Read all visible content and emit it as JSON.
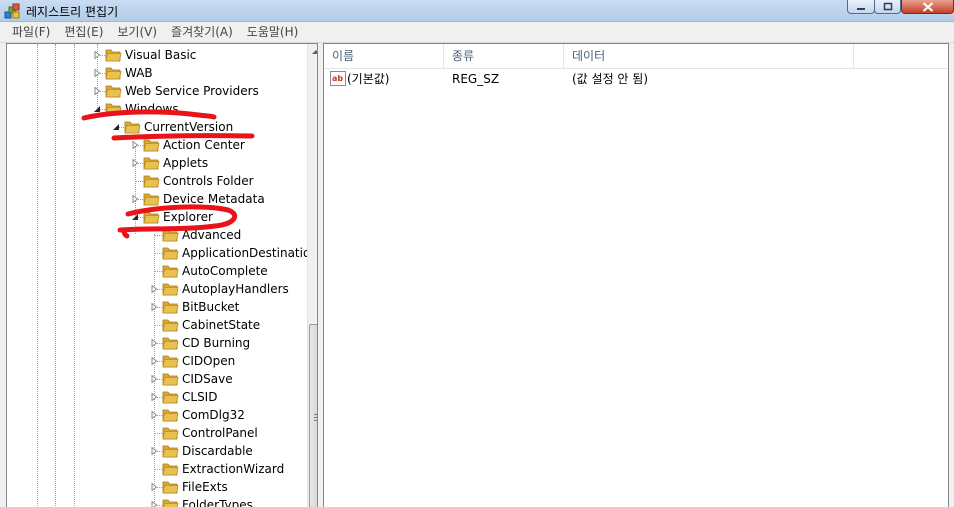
{
  "window": {
    "title": "레지스트리 편집기",
    "icons": {
      "app": "registry-editor-icon",
      "minimize": "minimize-icon",
      "maximize": "maximize-icon",
      "close": "close-icon"
    }
  },
  "menu": [
    "파일(F)",
    "편집(E)",
    "보기(V)",
    "즐겨찾기(A)",
    "도움말(H)"
  ],
  "tree": [
    {
      "label": "Visual Basic",
      "expander": "collapsed"
    },
    {
      "label": "WAB",
      "expander": "collapsed"
    },
    {
      "label": "Web Service Providers",
      "expander": "collapsed"
    },
    {
      "label": "Windows",
      "expander": "expanded"
    },
    {
      "label": "CurrentVersion",
      "expander": "expanded"
    },
    {
      "label": "Action Center",
      "expander": "collapsed"
    },
    {
      "label": "Applets",
      "expander": "collapsed"
    },
    {
      "label": "Controls Folder",
      "expander": "none"
    },
    {
      "label": "Device Metadata",
      "expander": "collapsed"
    },
    {
      "label": "Explorer",
      "expander": "expanded"
    },
    {
      "label": "Advanced",
      "expander": "none"
    },
    {
      "label": "ApplicationDestinations",
      "expander": "none"
    },
    {
      "label": "AutoComplete",
      "expander": "none"
    },
    {
      "label": "AutoplayHandlers",
      "expander": "collapsed"
    },
    {
      "label": "BitBucket",
      "expander": "collapsed"
    },
    {
      "label": "CabinetState",
      "expander": "none"
    },
    {
      "label": "CD Burning",
      "expander": "collapsed"
    },
    {
      "label": "CIDOpen",
      "expander": "collapsed"
    },
    {
      "label": "CIDSave",
      "expander": "collapsed"
    },
    {
      "label": "CLSID",
      "expander": "collapsed"
    },
    {
      "label": "ComDlg32",
      "expander": "collapsed"
    },
    {
      "label": "ControlPanel",
      "expander": "none"
    },
    {
      "label": "Discardable",
      "expander": "collapsed"
    },
    {
      "label": "ExtractionWizard",
      "expander": "none"
    },
    {
      "label": "FileExts",
      "expander": "collapsed"
    },
    {
      "label": "FolderTypes",
      "expander": "collapsed"
    }
  ],
  "list": {
    "columns": [
      "이름",
      "종류",
      "데이터"
    ],
    "rows": [
      {
        "name": "(기본값)",
        "type": "REG_SZ",
        "data": "(값 설정 안 됨)",
        "icon": "string-value-ab-icon"
      }
    ]
  },
  "colors": {
    "folder": "#e8c150",
    "annotation": "#e8141a",
    "header_text": "#4c607a"
  }
}
